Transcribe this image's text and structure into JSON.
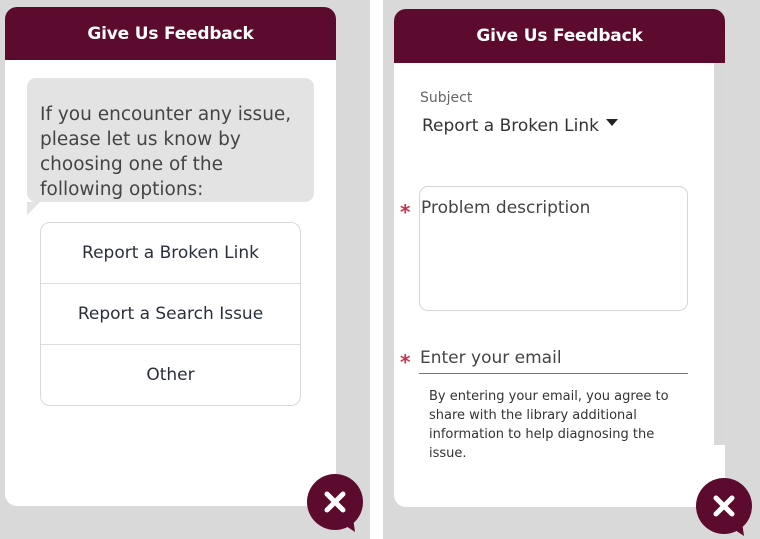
{
  "left_widget": {
    "title": "Give Us Feedback",
    "message": "If you encounter any issue, please let us know by choosing one of the following options:",
    "options": [
      "Report a Broken Link",
      "Report a Search Issue",
      "Other"
    ]
  },
  "right_widget": {
    "title": "Give Us Feedback",
    "subject_label": "Subject",
    "subject_value": "Report a Broken Link",
    "required_marker": "*",
    "description_placeholder": "Problem description",
    "email_placeholder": "Enter your email",
    "disclaimer": "By entering your email, you agree to share with the library additional information to help diagnosing the issue."
  },
  "icons": {
    "close": "close-icon",
    "dropdown": "caret-down-icon"
  },
  "colors": {
    "brand": "#5c0a2e",
    "required": "#c8324f"
  }
}
